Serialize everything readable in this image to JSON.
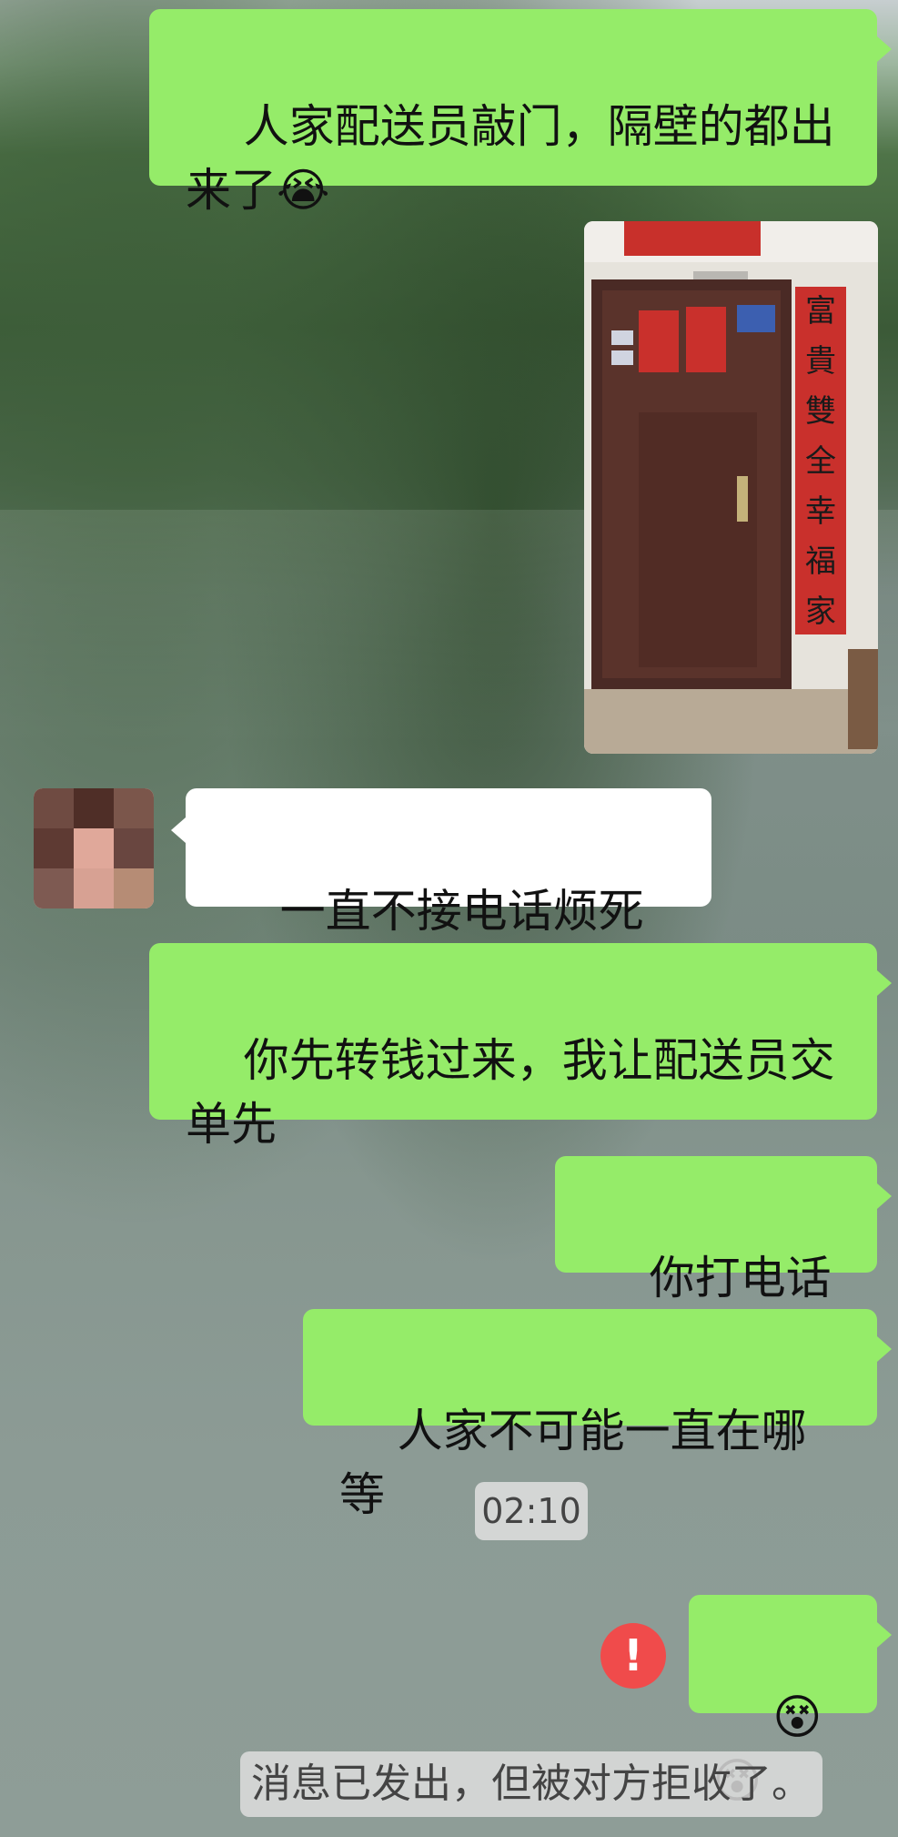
{
  "chat": {
    "messages": [
      {
        "type": "text",
        "direction": "out",
        "text": "人家配送员敲门，隔壁的都出来了😭"
      },
      {
        "type": "image",
        "direction": "out",
        "content": "photo of a brown apartment door with red couplets",
        "couplet_text": "富貴雙全幸福家"
      },
      {
        "type": "text",
        "direction": "in",
        "text": "一直不接电话烦死了"
      },
      {
        "type": "text",
        "direction": "out",
        "text": "你先转钱过来，我让配送员交单先"
      },
      {
        "type": "text",
        "direction": "out",
        "text": "你打电话咯"
      },
      {
        "type": "text",
        "direction": "out",
        "text": "人家不可能一直在哪等"
      },
      {
        "type": "timestamp",
        "text": "02:10"
      },
      {
        "type": "emoji",
        "direction": "out",
        "text": "😵😵",
        "status": "failed",
        "status_icon": "!"
      },
      {
        "type": "system",
        "text": "消息已发出，但被对方拒收了。"
      }
    ]
  }
}
